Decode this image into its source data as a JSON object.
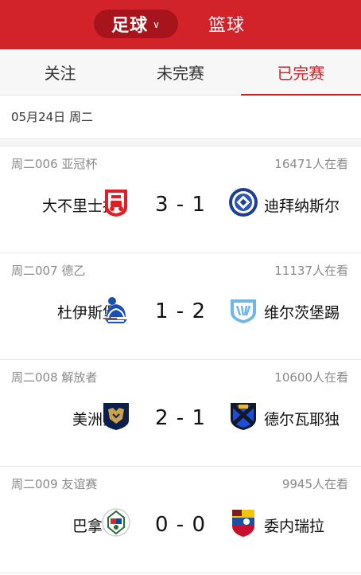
{
  "header": {
    "sport_active": "足球",
    "sport_other": "篮球"
  },
  "tabs": [
    {
      "label": "关注",
      "active": false
    },
    {
      "label": "未完赛",
      "active": false
    },
    {
      "label": "已完赛",
      "active": true
    }
  ],
  "date_label": "05月24日 周二",
  "matches": [
    {
      "code_league": "周二006 亚冠杯",
      "viewers": "16471人在看",
      "home": "大不里士拖",
      "score": "3 - 1",
      "away": "迪拜纳斯尔",
      "home_logo": "tractor-logo-icon",
      "away_logo": "al-nasr-logo-icon"
    },
    {
      "code_league": "周二007 德乙",
      "viewers": "11137人在看",
      "home": "杜伊斯堡",
      "score": "1 - 2",
      "away": "维尔茨堡踢",
      "home_logo": "duisburg-logo-icon",
      "away_logo": "wurzburg-logo-icon"
    },
    {
      "code_league": "周二008 解放者",
      "viewers": "10600人在看",
      "home": "美洲狮",
      "score": "2 - 1",
      "away": "德尔瓦耶独",
      "home_logo": "pumas-logo-icon",
      "away_logo": "independiente-del-valle-logo-icon"
    },
    {
      "code_league": "周二009 友谊赛",
      "viewers": "9945人在看",
      "home": "巴拿马",
      "score": "0 - 0",
      "away": "委内瑞拉",
      "home_logo": "panama-logo-icon",
      "away_logo": "venezuela-logo-icon"
    }
  ],
  "colors": {
    "brand_red": "#d2232a",
    "pill_red": "#a8141b"
  }
}
